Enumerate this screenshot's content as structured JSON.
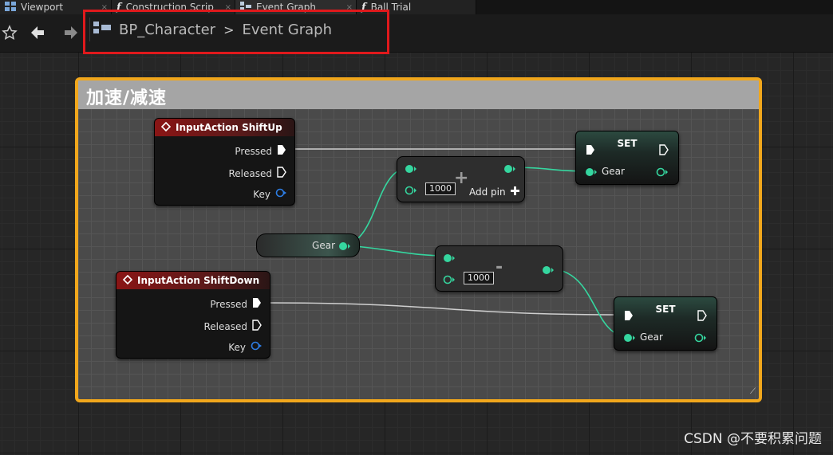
{
  "tabs": [
    {
      "label": "Viewport",
      "icon": "viewport-icon",
      "close": "×"
    },
    {
      "label": "Construction Scrip",
      "icon": "function-icon",
      "close": "×"
    },
    {
      "label": "Event Graph",
      "icon": "graph-icon",
      "close": "×",
      "active": true
    },
    {
      "label": "Ball Trial",
      "icon": "function-icon",
      "close": ""
    }
  ],
  "breadcrumb": {
    "blueprint": "BP_Character",
    "separator": ">",
    "graph": "Event Graph"
  },
  "comment": {
    "title": "加速/减速",
    "grip": "⟋"
  },
  "nodes": {
    "shift_up": {
      "title": "InputAction ShiftUp",
      "pressed": "Pressed",
      "released": "Released",
      "key": "Key"
    },
    "shift_down": {
      "title": "InputAction ShiftDown",
      "pressed": "Pressed",
      "released": "Released",
      "key": "Key"
    },
    "gear_get": {
      "label": "Gear"
    },
    "add": {
      "operator": "+",
      "value": "1000",
      "add_pin": "Add pin"
    },
    "subtract": {
      "operator": "-",
      "value": "1000"
    },
    "set_top": {
      "title": "SET",
      "var": "Gear"
    },
    "set_bottom": {
      "title": "SET",
      "var": "Gear"
    }
  },
  "colors": {
    "comment_border": "#f1a71c",
    "float_pin": "#35d69f",
    "event_header": "#8a1515",
    "highlight": "#e0191c"
  },
  "watermark": "CSDN @不要积累问题"
}
